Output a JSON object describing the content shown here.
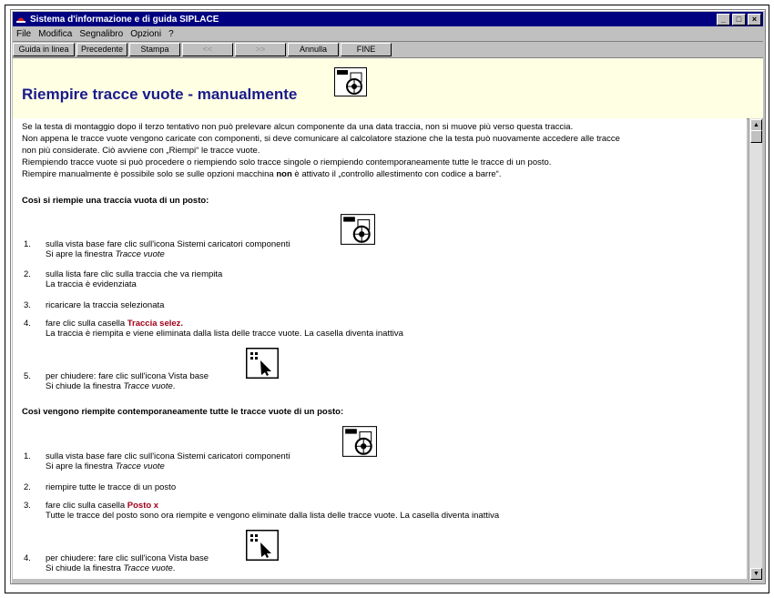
{
  "window": {
    "title": "Sistema d'informazione e di guida SIPLACE"
  },
  "menu": [
    {
      "label": "File"
    },
    {
      "label": "Modifica"
    },
    {
      "label": "Segnalibro"
    },
    {
      "label": "Opzioni"
    },
    {
      "label": "?"
    }
  ],
  "toolbar": [
    {
      "label": "Guida in linea",
      "enabled": true
    },
    {
      "label": "Precedente",
      "enabled": true
    },
    {
      "label": "Stampa",
      "enabled": true
    },
    {
      "label": "<<",
      "enabled": false
    },
    {
      "label": ">>",
      "enabled": false
    },
    {
      "label": "Annulla",
      "enabled": true
    },
    {
      "label": "FINE",
      "enabled": true
    }
  ],
  "page_title": "Riempire tracce vuote - manualmente",
  "intro": [
    "Se la testa di montaggio dopo il terzo tentativo non può prelevare alcun componente da una data traccia, non si muove più verso questa traccia.",
    "Non appena le tracce vuote vengono caricate con componenti, si deve comunicare al calcolatore stazione che la testa può nuovamente accedere alle tracce",
    "non più considerate. Ciò avviene con „Riempi“ le tracce vuote.",
    "Riempiendo tracce vuote si può procedere o riempiendo solo tracce singole o riempiendo contemporaneamente tutte le tracce di un posto.",
    "Riempire manualmente è possibile solo se sulle opzioni macchina",
    "non",
    "è attivato il  „controllo allestimento con codice a barre“."
  ],
  "section1": {
    "heading": "Così si riempie una traccia vuota di un posto:",
    "steps": [
      {
        "num": "1.",
        "line1": "sulla vista base fare clic sull'icona Sistemi caricatori componenti",
        "line2_prefix": "Si apre la finestra ",
        "line2_em": "Tracce vuote"
      },
      {
        "num": "2.",
        "line1": "sulla lista fare clic sulla traccia che va riempita",
        "line2": "La traccia è evidenziata"
      },
      {
        "num": "3.",
        "line1": "ricaricare la traccia selezionata"
      },
      {
        "num": "4.",
        "line1_prefix": "fare clic sulla casella ",
        "line1_red": "Traccia selez.",
        "line2": "La traccia è riempita e viene eliminata dalla lista delle tracce vuote. La casella diventa inattiva"
      },
      {
        "num": "5.",
        "line1": "per chiudere: fare clic sull'icona Vista base",
        "line2_prefix": "Si chiude la finestra ",
        "line2_em": "Tracce vuote",
        "line2_suffix": "."
      }
    ]
  },
  "section2": {
    "heading": "Così vengono riempite contemporaneamente tutte le tracce vuote di un posto:",
    "steps": [
      {
        "num": "1.",
        "line1": "sulla vista base fare clic sull'icona Sistemi caricatori componenti",
        "line2_prefix": "Si apre la finestra ",
        "line2_em": "Tracce vuote"
      },
      {
        "num": "2.",
        "line1": "riempire tutte le tracce di un posto"
      },
      {
        "num": "3.",
        "line1_prefix": "fare clic sulla casella ",
        "line1_red": "Posto x",
        "line2": "Tutte le tracce del posto sono ora riempite e vengono eliminate dalla lista delle tracce vuote. La casella diventa inattiva"
      },
      {
        "num": "4.",
        "line1": "per chiudere: fare clic sull'icona Vista base",
        "line2_prefix": "Si chiude la finestra ",
        "line2_em": "Tracce vuote",
        "line2_suffix": "."
      }
    ]
  }
}
